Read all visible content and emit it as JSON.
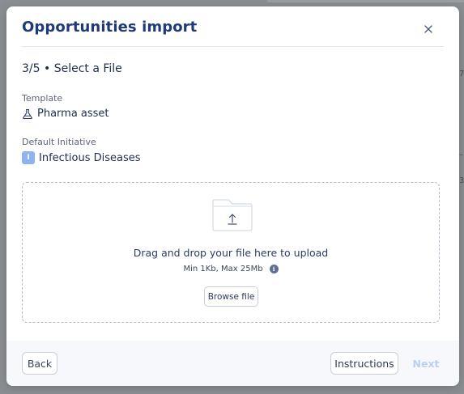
{
  "modal": {
    "title": "Opportunities import",
    "step": "3/5 • Select a File"
  },
  "template": {
    "label": "Template",
    "value": "Pharma asset",
    "icon": "flask-icon"
  },
  "initiative": {
    "label": "Default Initiative",
    "value": "Infectious Diseases",
    "badge_letter": "I",
    "badge_color": "#8fb3f0"
  },
  "upload": {
    "prompt": "Drag and drop your file here to upload",
    "limits": "Min 1Kb, Max 25Mb",
    "browse_label": "Browse file",
    "icon": "folder-upload-icon"
  },
  "footer": {
    "back_label": "Back",
    "instructions_label": "Instructions",
    "next_label": "Next"
  },
  "colors": {
    "title": "#1e3a7a",
    "next_disabled": "#b7d0f3"
  }
}
